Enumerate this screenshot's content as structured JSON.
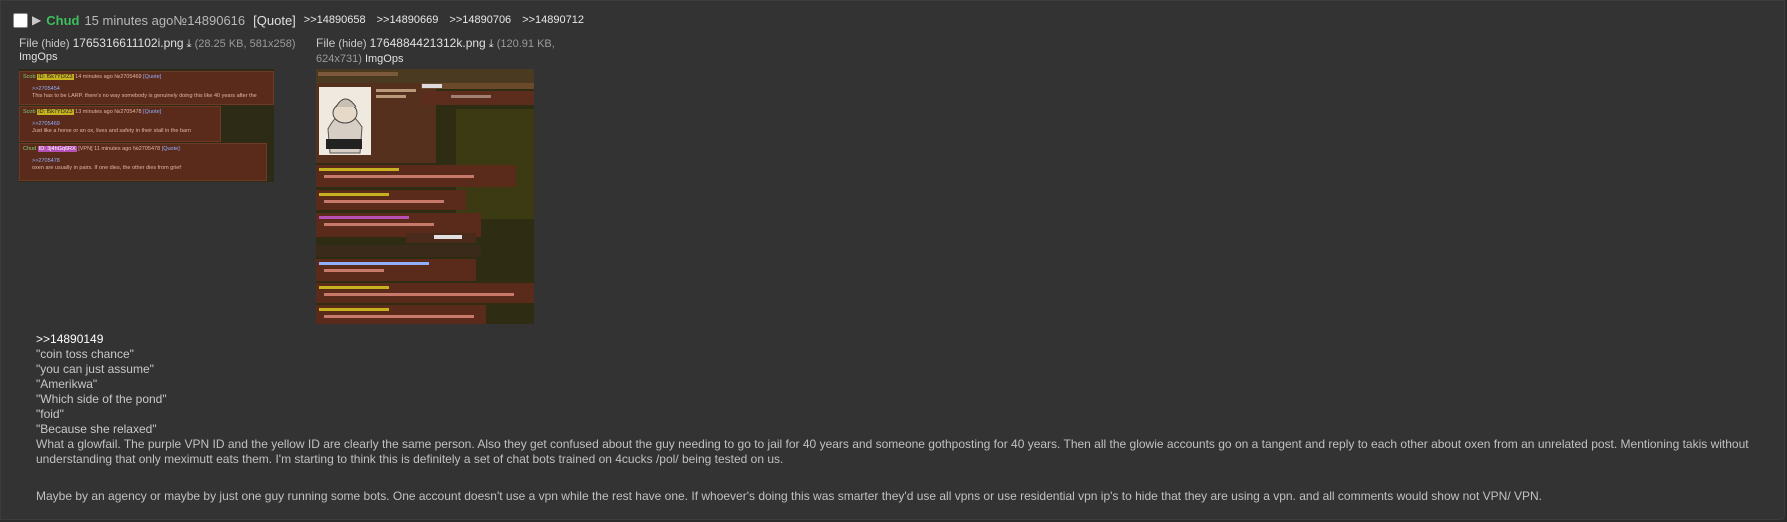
{
  "post": {
    "name": "Chud",
    "date": "15 minutes ago",
    "number": "№14890616",
    "quote_label": "[Quote]",
    "backlinks": [
      ">>14890658",
      ">>14890669",
      ">>14890706",
      ">>14890712"
    ]
  },
  "files": [
    {
      "label": "File",
      "hide": "(hide)",
      "filename": "1765316611102i.png",
      "meta": "(28.25 KB, 581x258)",
      "imgops": "ImgOps"
    },
    {
      "label": "File",
      "hide": "(hide)",
      "filename": "1764884421312k.png",
      "meta_line1": "(120.91 KB,",
      "meta_line2": "624x731)",
      "imgops": "ImgOps"
    }
  ],
  "thumb1": {
    "posts": [
      {
        "name": "Scob",
        "id": "ID: f5k7YD/Z3",
        "time": "14 minutes ago №2705469",
        "link": "[Quote]",
        "ref": ">>2705454",
        "text": "This has to be LARP. there's no way somebody is genuinely doing this like 40 years after the"
      },
      {
        "name": "Scob",
        "id": "ID: f5k7YD/Z3",
        "time": "13 minutes ago №2705478",
        "link": "[Quote]",
        "ref": ">>2705469",
        "text": "Just like a horse or an ox, lives and safety in their stall in the barn"
      },
      {
        "name": "Chud",
        "id": "ID: 3j4hGq6RX",
        "time": "[VPN] 11 minutes ago №2705478",
        "link": "[Quote]",
        "ref": ">>2705478",
        "text": "oxen are usually in pairs. If one dies, the other dies from grief"
      }
    ]
  },
  "body": {
    "quotelink": ">>14890149",
    "greentext": [
      "\"coin toss chance\"",
      "\"you can just assume\"",
      "\"Amerikwa\"",
      "\"Which side of the pond\"",
      "\"foid\"",
      "\"Because she relaxed\""
    ],
    "paragraph1_line1": "What a glowfail. The purple VPN ID and the yellow ID are clearly the same person. Also they get confused about the guy needing to go to jail for 40 years and someone gothposting for 40 years. Then all the glowie accounts go on a tangent and reply to each other about oxen from an unrelated post. Mentioning takis without",
    "paragraph1_line2": "understanding that only meximutt eats them. I'm starting to think this is definitely a set of chat bots trained on 4cucks /pol/ being tested on us.",
    "paragraph2": "Maybe by an agency or maybe by just one guy running some bots. One account doesn't use a vpn while the rest have one. If whoever's doing this was smarter they'd use all vpns or use residential vpn ip's to hide that they are using a vpn. and all comments would show not VPN/ VPN."
  },
  "colors": {
    "background": "#333333",
    "name": "#3cbf5c",
    "text": "#c0c0c0"
  }
}
